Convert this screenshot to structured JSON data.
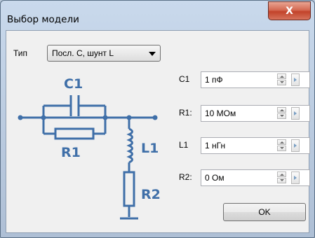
{
  "window": {
    "title": "Выбор модели",
    "close_label": "X"
  },
  "type_selector": {
    "label": "Тип",
    "value": "Посл. C, шунт L"
  },
  "schematic": {
    "labels": [
      "C1",
      "R1",
      "L1",
      "R2"
    ],
    "color": "#3f6fa8"
  },
  "params": [
    {
      "label": "C1",
      "value": "1 пФ"
    },
    {
      "label": "R1:",
      "value": "10 МОм"
    },
    {
      "label": "L1",
      "value": "1 нГн"
    },
    {
      "label": "R2:",
      "value": "0 Ом"
    }
  ],
  "ok_label": "OK"
}
